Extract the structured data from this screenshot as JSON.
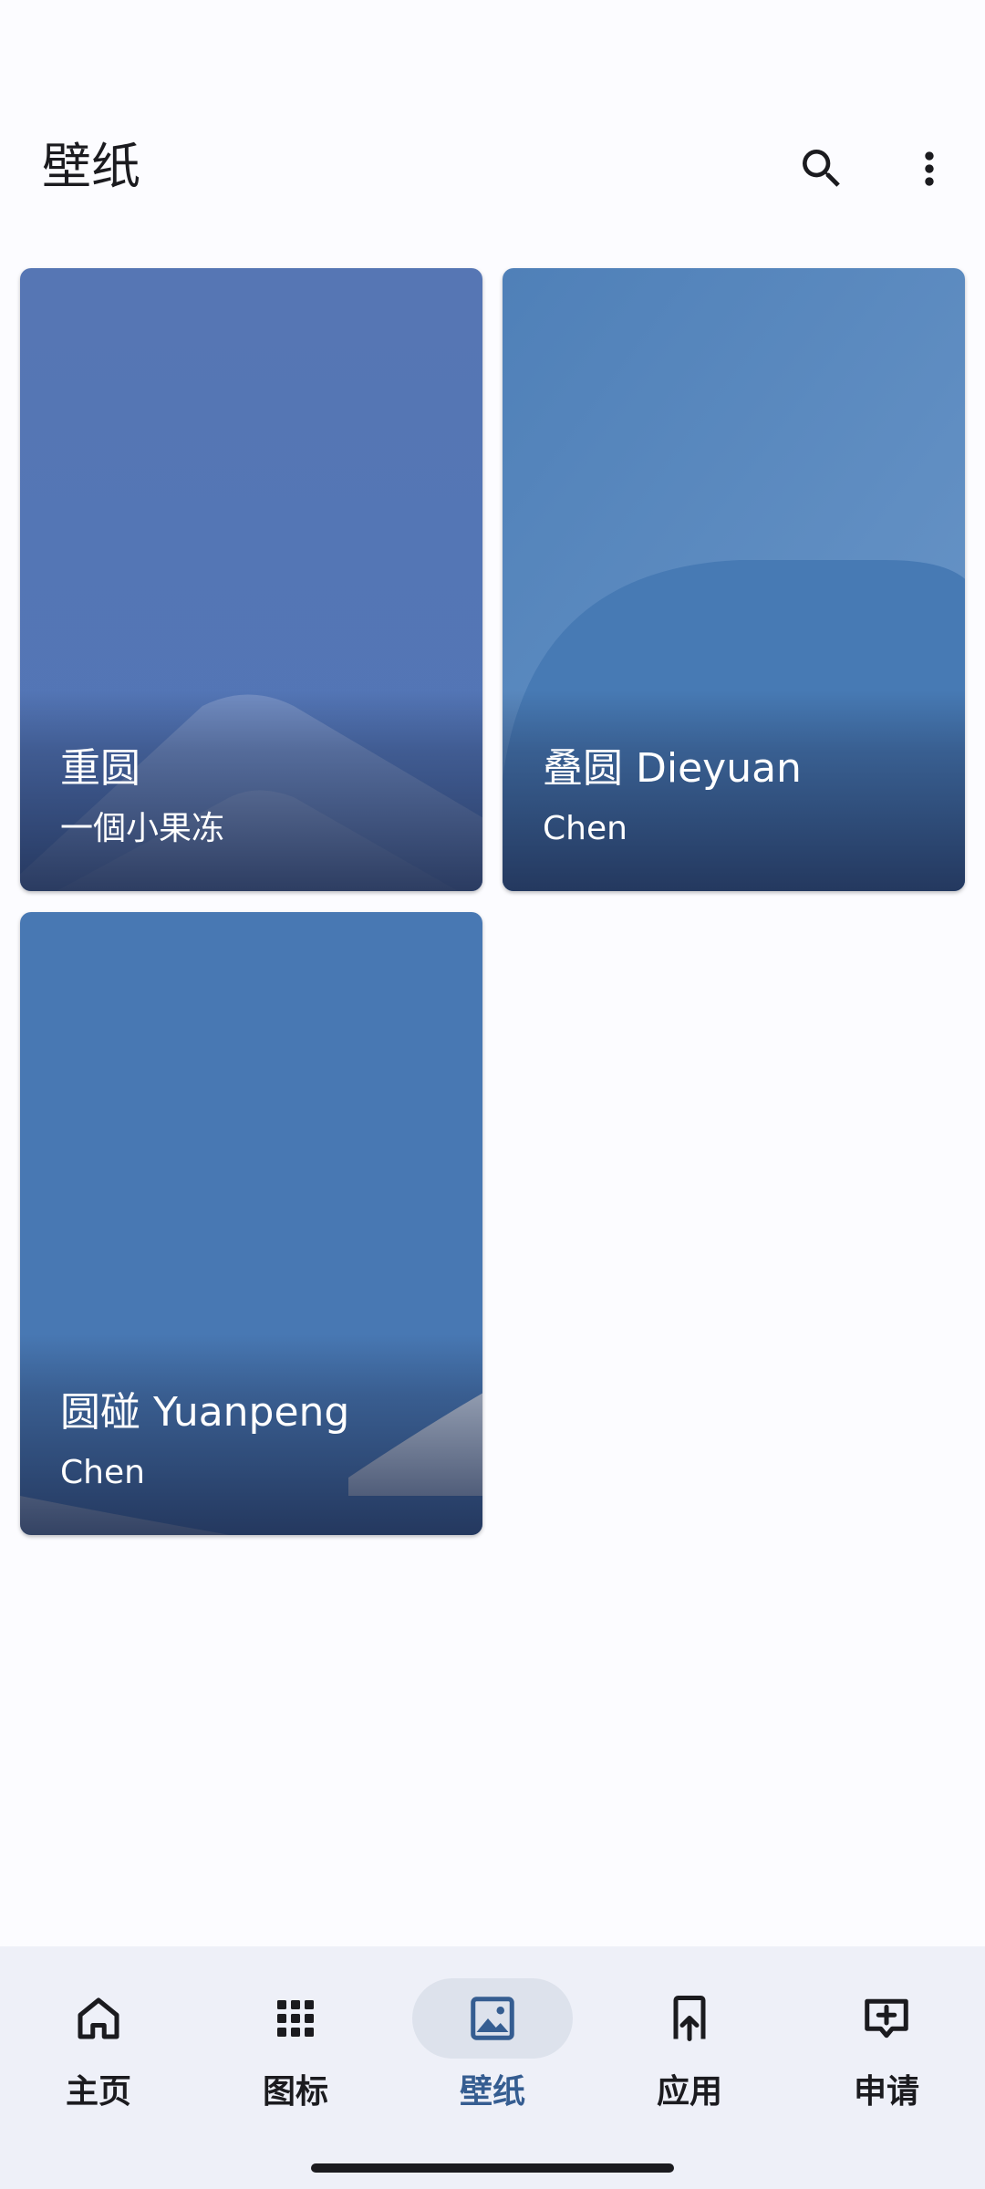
{
  "header": {
    "title": "壁纸"
  },
  "wallpapers": [
    {
      "title": "重圆",
      "author": "一個小果冻"
    },
    {
      "title": "叠圆 Dieyuan",
      "author": "Chen"
    },
    {
      "title": "圆碰 Yuanpeng",
      "author": "Chen"
    }
  ],
  "nav": {
    "items": [
      {
        "label": "主页",
        "icon": "home-icon"
      },
      {
        "label": "图标",
        "icon": "apps-grid-icon"
      },
      {
        "label": "壁纸",
        "icon": "image-icon",
        "active": true
      },
      {
        "label": "应用",
        "icon": "app-upload-icon"
      },
      {
        "label": "申请",
        "icon": "add-comment-icon"
      }
    ]
  },
  "colors": {
    "background": "#fcfcff",
    "nav_background": "#eef0f8",
    "active_accent": "#355d91",
    "active_pill": "#dde2ec"
  }
}
